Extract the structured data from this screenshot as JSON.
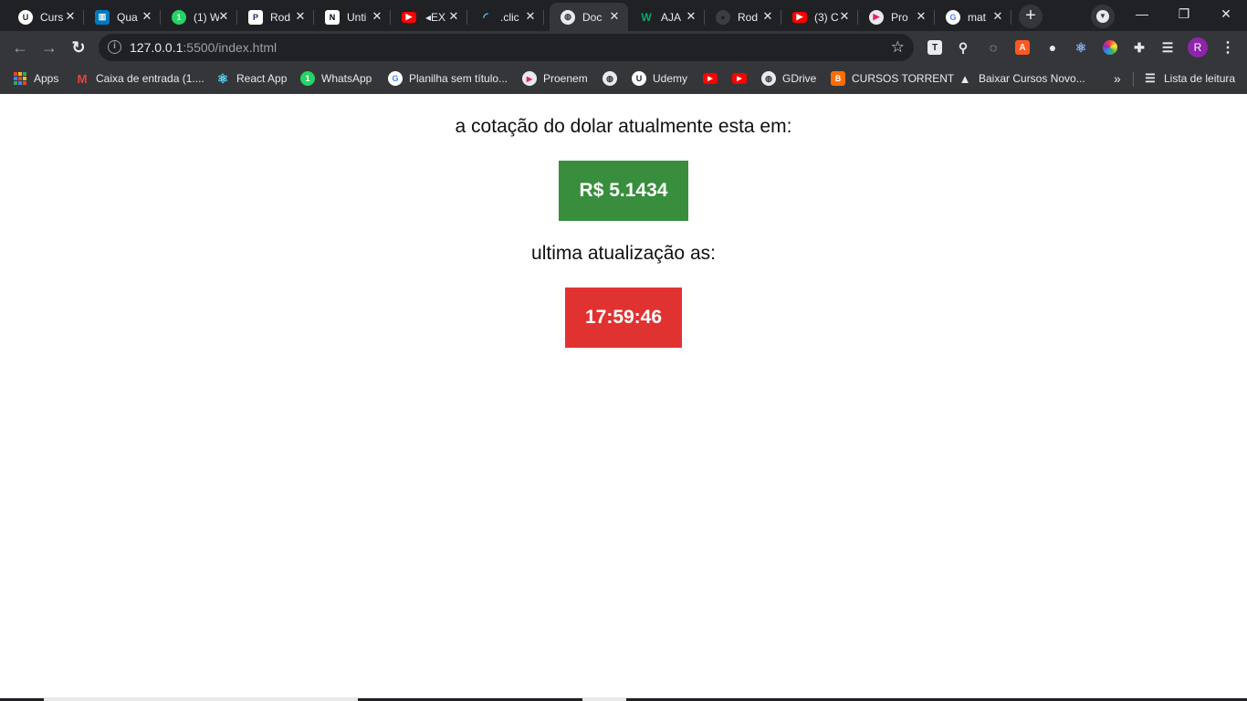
{
  "tabs": [
    {
      "title": "Curs",
      "icon": "udemy-icon",
      "color": "#ffffff"
    },
    {
      "title": "Qua",
      "icon": "trello-icon",
      "color": "#0079bf"
    },
    {
      "title": "(1) W",
      "icon": "whatsapp-icon",
      "color": "#25d366"
    },
    {
      "title": "Rod",
      "icon": "proenem-p-icon",
      "color": "#ffffff"
    },
    {
      "title": "Unti",
      "icon": "notion-icon",
      "color": "#ffffff"
    },
    {
      "title": "EX",
      "icon": "youtube-icon",
      "color": "#ff0000"
    },
    {
      "title": ".clic",
      "icon": "wave-icon",
      "color": "#4fc3f7"
    },
    {
      "title": "Doc",
      "icon": "globe-icon",
      "color": "#e8eaed",
      "active": true
    },
    {
      "title": "AJA",
      "icon": "w3schools-icon",
      "color": "#04aa6d"
    },
    {
      "title": "Rod",
      "icon": "github-icon",
      "color": "#3c3d41"
    },
    {
      "title": "(3) C",
      "icon": "youtube-icon",
      "color": "#ff0000"
    },
    {
      "title": "Pro",
      "icon": "proenem-icon",
      "color": "#e91e63"
    },
    {
      "title": "mat",
      "icon": "google-icon",
      "color": "#ffffff"
    }
  ],
  "toolbar": {
    "url_host": "127.0.0.1",
    "url_rest": ":5500/index.html",
    "profile_initial": "R"
  },
  "bookmarks": {
    "apps": "Apps",
    "gmail": "Caixa de entrada (1....",
    "react": "React App",
    "whatsapp": "WhatsApp",
    "planilha": "Planilha sem título...",
    "proenem": "Proenem",
    "udemy": "Udemy",
    "gdrive": "GDrive",
    "cursos": "CURSOS TORRENT",
    "baixar": "Baixar Cursos Novo...",
    "more": "»",
    "reading_list": "Lista de leitura"
  },
  "page": {
    "dollar_label": "a cotação do dolar atualmente esta em:",
    "dollar_value": "R$ 5.1434",
    "update_label": "ultima atualização as:",
    "update_time": "17:59:46"
  },
  "colors": {
    "value_box": "#388e3c",
    "time_box": "#e03331",
    "chrome_dark": "#202124",
    "chrome_toolbar": "#35363a"
  }
}
